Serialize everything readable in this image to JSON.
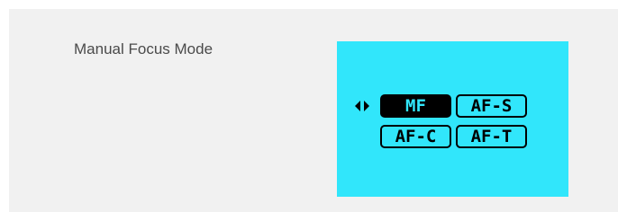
{
  "caption": "Manual Focus Mode",
  "screen": {
    "background": "#31e6fb",
    "indicator_icon": "left-right-arrows-icon",
    "selected": "MF",
    "options": [
      {
        "label": "MF"
      },
      {
        "label": "AF-S"
      },
      {
        "label": "AF-C"
      },
      {
        "label": "AF-T"
      }
    ]
  }
}
